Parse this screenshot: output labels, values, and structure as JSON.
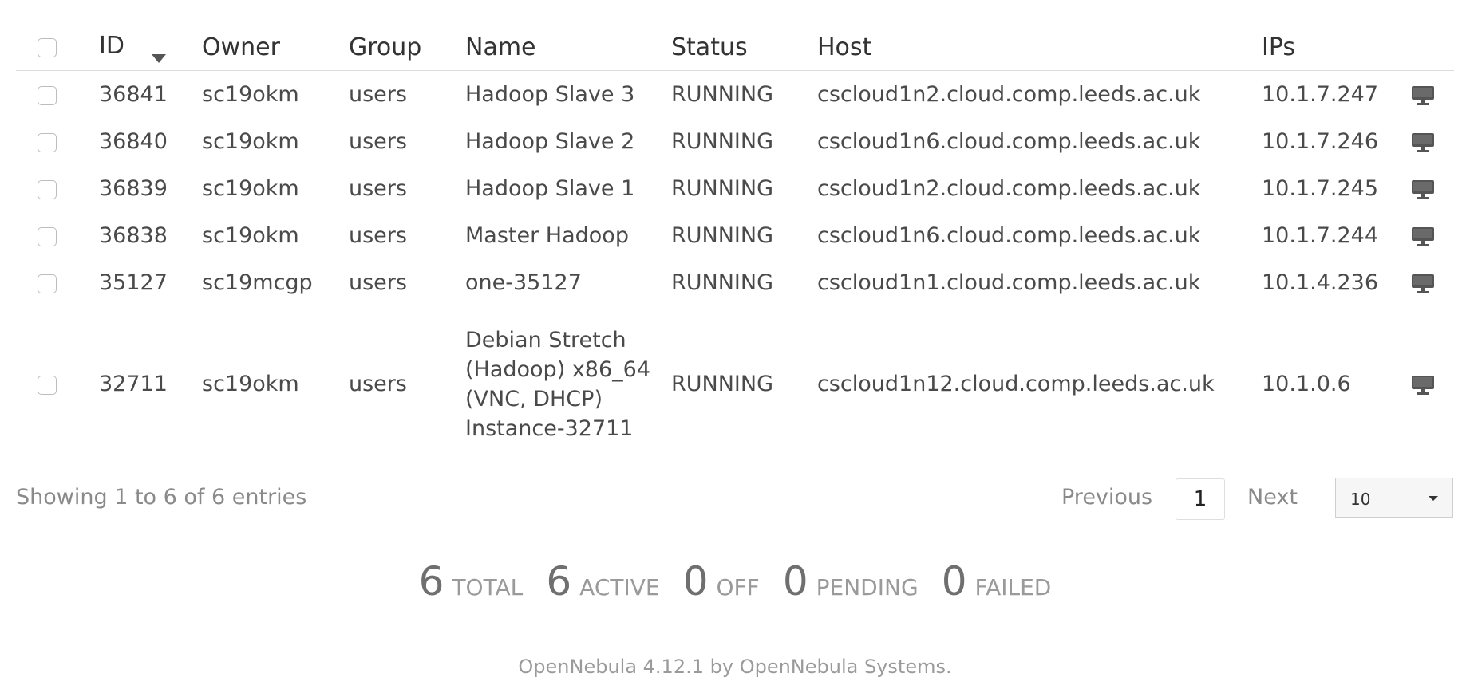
{
  "table": {
    "headers": {
      "id": "ID",
      "owner": "Owner",
      "group": "Group",
      "name": "Name",
      "status": "Status",
      "host": "Host",
      "ips": "IPs"
    },
    "rows": [
      {
        "id": "36841",
        "owner": "sc19okm",
        "group": "users",
        "name": "Hadoop Slave 3",
        "status": "RUNNING",
        "host": "cscloud1n2.cloud.comp.leeds.ac.uk",
        "ips": "10.1.7.247"
      },
      {
        "id": "36840",
        "owner": "sc19okm",
        "group": "users",
        "name": "Hadoop Slave 2",
        "status": "RUNNING",
        "host": "cscloud1n6.cloud.comp.leeds.ac.uk",
        "ips": "10.1.7.246"
      },
      {
        "id": "36839",
        "owner": "sc19okm",
        "group": "users",
        "name": "Hadoop Slave 1",
        "status": "RUNNING",
        "host": "cscloud1n2.cloud.comp.leeds.ac.uk",
        "ips": "10.1.7.245"
      },
      {
        "id": "36838",
        "owner": "sc19okm",
        "group": "users",
        "name": "Master Hadoop",
        "status": "RUNNING",
        "host": "cscloud1n6.cloud.comp.leeds.ac.uk",
        "ips": "10.1.7.244"
      },
      {
        "id": "35127",
        "owner": "sc19mcgp",
        "group": "users",
        "name": "one-35127",
        "status": "RUNNING",
        "host": "cscloud1n1.cloud.comp.leeds.ac.uk",
        "ips": "10.1.4.236"
      },
      {
        "id": "32711",
        "owner": "sc19okm",
        "group": "users",
        "name": "Debian Stretch (Hadoop) x86_64 (VNC, DHCP) Instance-32711",
        "status": "RUNNING",
        "host": "cscloud1n12.cloud.comp.leeds.ac.uk",
        "ips": "10.1.0.6"
      }
    ],
    "row_icon": "monitor-icon"
  },
  "pagination": {
    "showing": "Showing 1 to 6 of 6 entries",
    "previous": "Previous",
    "page": "1",
    "next": "Next",
    "page_size": "10"
  },
  "summary": [
    {
      "count": "6",
      "label": "TOTAL"
    },
    {
      "count": "6",
      "label": "ACTIVE"
    },
    {
      "count": "0",
      "label": "OFF"
    },
    {
      "count": "0",
      "label": "PENDING"
    },
    {
      "count": "0",
      "label": "FAILED"
    }
  ],
  "footer": {
    "text": "OpenNebula 4.12.1 by OpenNebula Systems."
  }
}
